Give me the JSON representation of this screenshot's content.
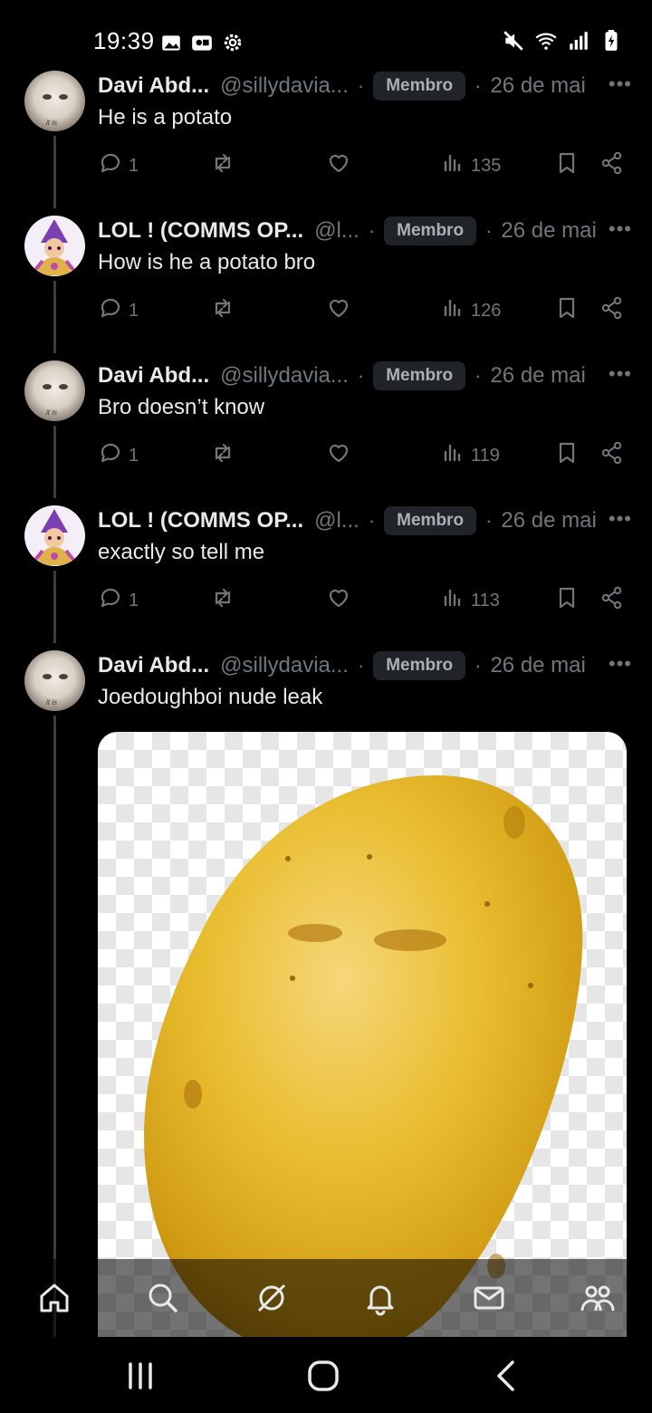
{
  "status_bar": {
    "time": "19:39"
  },
  "posts": [
    {
      "author": "Davi Abd...",
      "handle": "@sillydavia...",
      "badge": "Membro",
      "date": "26 de mai",
      "text": "He is a potato",
      "replies": "1",
      "views": "135",
      "avatar": "cat"
    },
    {
      "author": "LOL ! (COMMS OP...",
      "handle": "@l...",
      "badge": "Membro",
      "date": "26 de mai",
      "text": "How is he a potato bro",
      "replies": "1",
      "views": "126",
      "avatar": "wizard"
    },
    {
      "author": "Davi Abd...",
      "handle": "@sillydavia...",
      "badge": "Membro",
      "date": "26 de mai",
      "text": "Bro doesn’t know",
      "replies": "1",
      "views": "119",
      "avatar": "cat"
    },
    {
      "author": "LOL ! (COMMS OP...",
      "handle": "@l...",
      "badge": "Membro",
      "date": "26 de mai",
      "text": "exactly so tell me",
      "replies": "1",
      "views": "113",
      "avatar": "wizard"
    },
    {
      "author": "Davi Abd...",
      "handle": "@sillydavia...",
      "badge": "Membro",
      "date": "26 de mai",
      "text": "Joedoughboi nude leak",
      "avatar": "cat",
      "image": "potato-image"
    }
  ],
  "bottom_nav": [
    "home-icon",
    "search-icon",
    "grok-icon",
    "notifications-icon",
    "messages-icon",
    "communities-icon"
  ],
  "system_nav": [
    "recents-icon",
    "home-button-icon",
    "back-icon"
  ],
  "colors": {
    "background": "#000000",
    "text": "#e7e9ea",
    "muted": "#71767b",
    "badge_bg": "#202327"
  }
}
